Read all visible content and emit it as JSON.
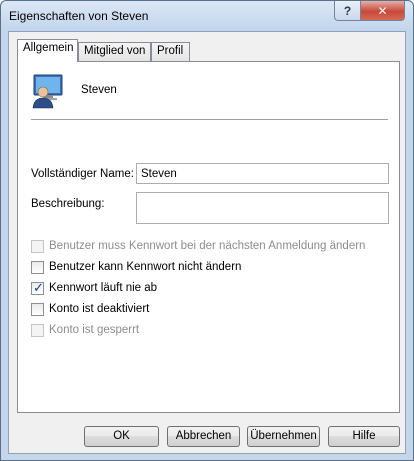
{
  "window": {
    "title": "Eigenschaften von Steven"
  },
  "title_buttons": {
    "help": "?",
    "close": "✕"
  },
  "tabs": [
    {
      "label": "Allgemein",
      "active": true
    },
    {
      "label": "Mitglied von",
      "active": false
    },
    {
      "label": "Profil",
      "active": false
    }
  ],
  "user": {
    "name": "Steven",
    "icon": "user-account-icon"
  },
  "fields": {
    "fullname_label": "Vollständiger Name:",
    "fullname_value": "Steven",
    "description_label": "Beschreibung:",
    "description_value": ""
  },
  "checkboxes": [
    {
      "label": "Benutzer muss Kennwort bei der nächsten Anmeldung ändern",
      "checked": false,
      "enabled": false
    },
    {
      "label": "Benutzer kann Kennwort nicht ändern",
      "checked": false,
      "enabled": true
    },
    {
      "label": "Kennwort läuft nie ab",
      "checked": true,
      "enabled": true
    },
    {
      "label": "Konto ist deaktiviert",
      "checked": false,
      "enabled": true
    },
    {
      "label": "Konto ist gesperrt",
      "checked": false,
      "enabled": false
    }
  ],
  "buttons": {
    "ok": "OK",
    "cancel": "Abbrechen",
    "apply": "Übernehmen",
    "help": "Hilfe"
  }
}
